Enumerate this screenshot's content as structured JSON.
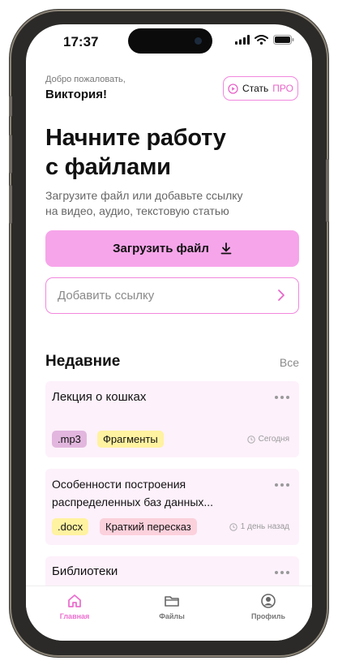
{
  "status": {
    "time": "17:37"
  },
  "header": {
    "welcome_text": "Добро пожаловать,",
    "user_name": "Виктория!",
    "pro_prefix": "Стать",
    "pro_suffix": "ПРО"
  },
  "hero": {
    "headline_line1": "Начните работу",
    "headline_line2": "с файлами",
    "subtext_line1": "Загрузите файл или добавьте ссылку",
    "subtext_line2": "на видео, аудио, текстовую статью"
  },
  "actions": {
    "upload_label": "Загрузить файл",
    "link_placeholder": "Добавить ссылку"
  },
  "recent": {
    "title": "Недавние",
    "see_all": "Все",
    "items": [
      {
        "title_line1": "Лекция о кошках",
        "format": ".mp3",
        "tag": "Фрагменты",
        "date": "Сегодня"
      },
      {
        "title_line1": "Особенности построения",
        "title_line2": "распределенных баз данных...",
        "format": ".docx",
        "tag": "Краткий пересказ",
        "date": "1 день назад"
      },
      {
        "title_line1": "Библиотеки"
      }
    ]
  },
  "nav": {
    "items": [
      {
        "label": "Главная",
        "icon": "home-icon",
        "active": true
      },
      {
        "label": "Файлы",
        "icon": "folder-icon",
        "active": false
      },
      {
        "label": "Профиль",
        "icon": "profile-icon",
        "active": false
      }
    ]
  },
  "colors": {
    "accent": "#f287de",
    "accent_fill": "#f6a5ea",
    "card_bg": "#fdf1fb",
    "tag_yellow": "#fff2a0",
    "tag_pink": "#fbd1dc",
    "tag_mp3": "#e2b6de"
  }
}
